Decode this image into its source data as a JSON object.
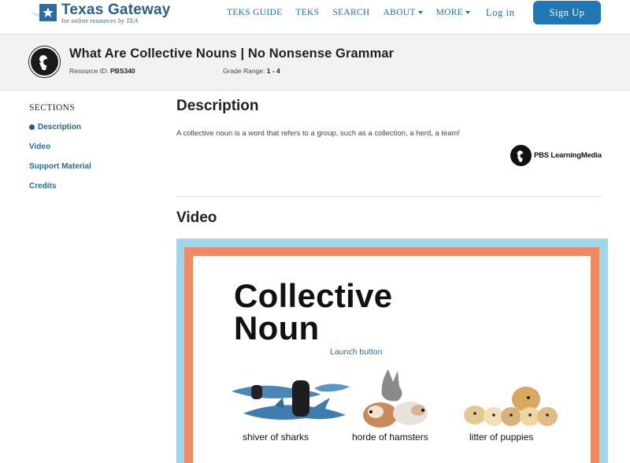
{
  "nav": {
    "logo_title": "Texas Gateway",
    "logo_subtitle": "for online resources",
    "logo_by": "by TEA",
    "links": [
      "TEKS GUIDE",
      "TEKS",
      "SEARCH",
      "ABOUT",
      "MORE"
    ],
    "login": "Log in",
    "signup": "Sign Up"
  },
  "resource": {
    "title": "What Are Collective Nouns | No Nonsense Grammar",
    "id_label": "Resource ID:",
    "id_value": "PBS340",
    "grade_label": "Grade Range:",
    "grade_value": "1 - 4"
  },
  "sidebar": {
    "heading": "SECTIONS",
    "items": [
      "Description",
      "Video",
      "Support Material",
      "Credits"
    ]
  },
  "description": {
    "heading": "Description",
    "text": "A collective noun is a word that refers to a group, such as a collection, a herd, a team!",
    "partner": "PBS LearningMedia"
  },
  "video": {
    "heading": "Video",
    "slide_title_line1": "Collective",
    "slide_title_line2": "Noun",
    "launch": "Launch button",
    "captions": [
      "shiver of sharks",
      "horde of hamsters",
      "litter of puppies"
    ]
  },
  "colors": {
    "brand_blue": "#1f78b4",
    "link_blue": "#1f6ea3",
    "video_border_blue": "#9fd6ea",
    "video_border_orange": "#f08a62"
  }
}
